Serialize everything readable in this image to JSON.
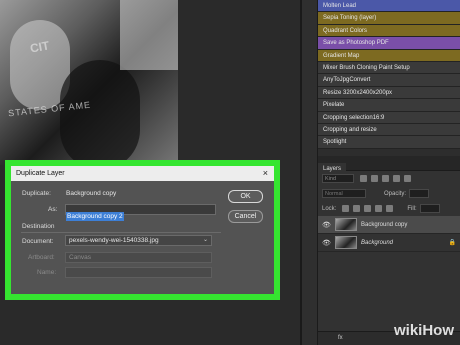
{
  "canvas": {
    "photo_text": "STATES OF AME",
    "photo_text2": "CIT"
  },
  "actions_panel": {
    "items": [
      {
        "label": "Molten Lead",
        "color": "#4b58a8"
      },
      {
        "label": "Sepia Toning (layer)",
        "color": "#7d6a21"
      },
      {
        "label": "Quadrant Colors",
        "color": "#7d6a21"
      },
      {
        "label": "Save as Photoshop PDF",
        "color": "#7a4fa8"
      },
      {
        "label": "Gradient Map",
        "color": "#7d6a21"
      },
      {
        "label": "Mixer Brush Cloning Paint Setup",
        "color": "#3a3a3a"
      },
      {
        "label": "AnyToJpgConvert",
        "color": "#3a3a3a"
      },
      {
        "label": "Resize 3200x2400x200px",
        "color": "#3a3a3a"
      },
      {
        "label": "Pixelate",
        "color": "#3a3a3a"
      },
      {
        "label": "Cropping selection16:9",
        "color": "#3a3a3a"
      },
      {
        "label": "Cropping and resize",
        "color": "#3a3a3a"
      },
      {
        "label": "Spotlight",
        "color": "#3a3a3a"
      }
    ]
  },
  "layers_panel": {
    "tab": "Layers",
    "kind_placeholder": "Kind",
    "blend_mode": "Normal",
    "opacity_label": "Opacity:",
    "fill_label": "Fill:",
    "lock_label": "Lock:",
    "layers": [
      {
        "name": "Background copy",
        "selected": true,
        "italic": false,
        "locked": false
      },
      {
        "name": "Background",
        "selected": false,
        "italic": true,
        "locked": true
      }
    ],
    "footer_icons": "fx"
  },
  "dialog": {
    "title": "Duplicate Layer",
    "close_glyph": "×",
    "duplicate_label": "Duplicate:",
    "duplicate_value": "Background copy",
    "as_label": "As:",
    "as_value": "Background copy 2",
    "destination_label": "Destination",
    "document_label": "Document:",
    "document_value": "pexels-wendy-wei-1540338.jpg",
    "artboard_label": "Artboard:",
    "artboard_value": "Canvas",
    "name_label": "Name:",
    "ok_label": "OK",
    "cancel_label": "Cancel"
  },
  "highlight_color": "#35e530",
  "watermark": "wikiHow"
}
